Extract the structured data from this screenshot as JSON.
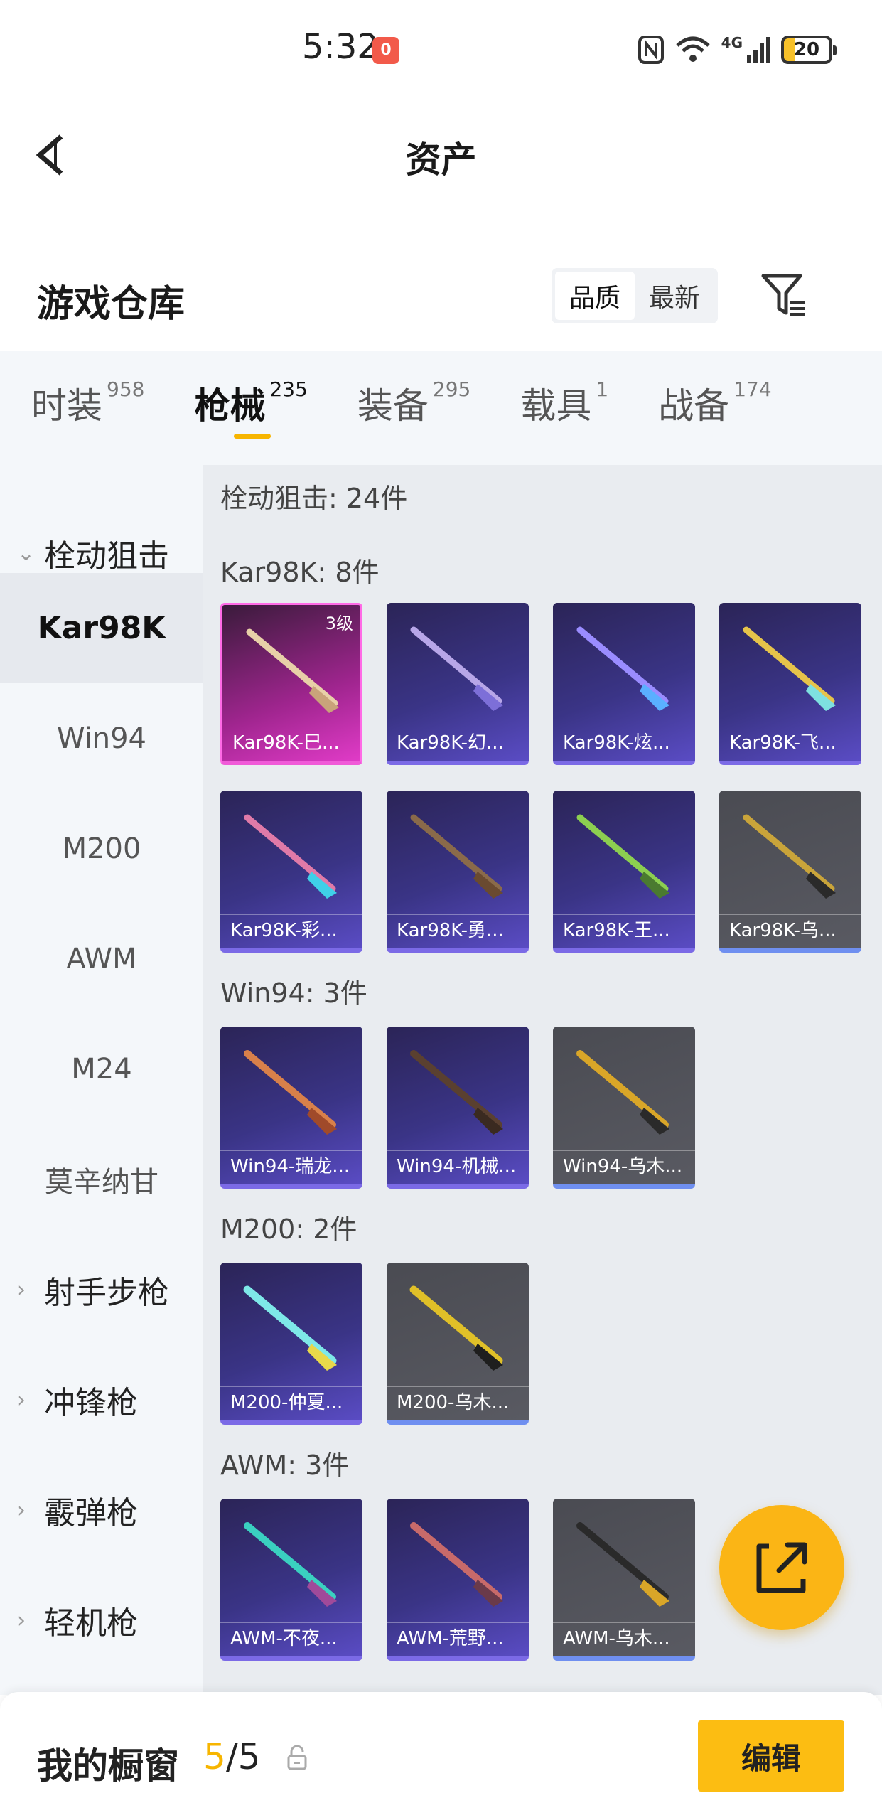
{
  "status_bar": {
    "time": "5:32",
    "notification_badge": "0",
    "network": "4G",
    "battery": "20"
  },
  "header": {
    "title": "资产"
  },
  "warehouse": {
    "title": "游戏仓库",
    "sort_options": [
      "品质",
      "最新"
    ],
    "active_sort": "品质"
  },
  "category_tabs": [
    {
      "label": "时装",
      "count": "958"
    },
    {
      "label": "枪械",
      "count": "235",
      "active": true
    },
    {
      "label": "装备",
      "count": "295"
    },
    {
      "label": "载具",
      "count": "1"
    },
    {
      "label": "战备",
      "count": "174"
    }
  ],
  "sidebar": {
    "expanded_group": "栓动狙击",
    "sub_items": [
      "Kar98K",
      "Win94",
      "M200",
      "AWM",
      "M24",
      "莫辛纳甘"
    ],
    "active_sub": "Kar98K",
    "collapsed_groups": [
      "射手步枪",
      "冲锋枪",
      "霰弹枪",
      "轻机枪"
    ]
  },
  "content": {
    "summary": "栓动狙击: 24件",
    "sections": [
      {
        "header": "Kar98K: 8件",
        "items": [
          {
            "name": "Kar98K-巳...",
            "rarity": "pink",
            "level": "3级"
          },
          {
            "name": "Kar98K-幻...",
            "rarity": "purple"
          },
          {
            "name": "Kar98K-炫...",
            "rarity": "purple"
          },
          {
            "name": "Kar98K-飞...",
            "rarity": "purple"
          },
          {
            "name": "Kar98K-彩...",
            "rarity": "purple"
          },
          {
            "name": "Kar98K-勇...",
            "rarity": "purple"
          },
          {
            "name": "Kar98K-王...",
            "rarity": "purple"
          },
          {
            "name": "Kar98K-乌...",
            "rarity": "gray"
          }
        ]
      },
      {
        "header": "Win94: 3件",
        "items": [
          {
            "name": "Win94-瑞龙...",
            "rarity": "purple"
          },
          {
            "name": "Win94-机械...",
            "rarity": "purple"
          },
          {
            "name": "Win94-乌木...",
            "rarity": "gray"
          }
        ]
      },
      {
        "header": "M200: 2件",
        "items": [
          {
            "name": "M200-仲夏...",
            "rarity": "purple"
          },
          {
            "name": "M200-乌木...",
            "rarity": "gray"
          }
        ]
      },
      {
        "header": "AWM: 3件",
        "items": [
          {
            "name": "AWM-不夜...",
            "rarity": "purple"
          },
          {
            "name": "AWM-荒野...",
            "rarity": "purple"
          },
          {
            "name": "AWM-乌木...",
            "rarity": "gray"
          }
        ]
      }
    ]
  },
  "bottom_bar": {
    "title": "我的橱窗",
    "count_current": "5",
    "count_sep_total": "/5",
    "edit_label": "编辑"
  },
  "colors": {
    "accent": "#f7b500",
    "edit_button": "#fcbd12",
    "card_purple": "#3a3486",
    "card_pink": "#e03bc7",
    "card_gray": "#595a62"
  }
}
